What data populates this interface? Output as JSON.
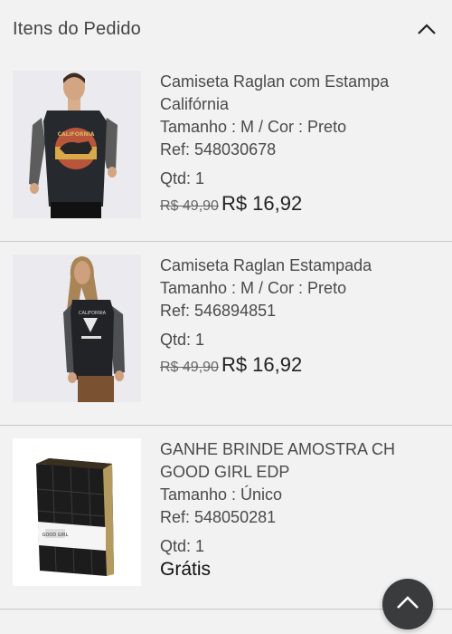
{
  "header": {
    "title": "Itens do Pedido",
    "collapse_icon": "chevron-up-icon"
  },
  "items": [
    {
      "name_line1": "Camiseta Raglan com Estampa",
      "name_line2": "Califórnia",
      "attributes": "Tamanho : M / Cor : Preto",
      "ref": "Ref: 548030678",
      "qty": "Qtd: 1",
      "old_price": "R$ 49,90",
      "new_price": "R$ 16,92"
    },
    {
      "name_line1": "Camiseta Raglan Estampada",
      "attributes": "Tamanho : M / Cor : Preto",
      "ref": "Ref: 546894851",
      "qty": "Qtd: 1",
      "old_price": "R$ 49,90",
      "new_price": "R$ 16,92"
    },
    {
      "name_line1": "GANHE BRINDE AMOSTRA CH",
      "name_line2": "GOOD GIRL EDP",
      "attributes": "Tamanho : Único",
      "ref": "Ref: 548050281",
      "qty": "Qtd: 1",
      "price_label": "Grátis"
    }
  ],
  "scroll_top_icon": "chevron-up-icon"
}
